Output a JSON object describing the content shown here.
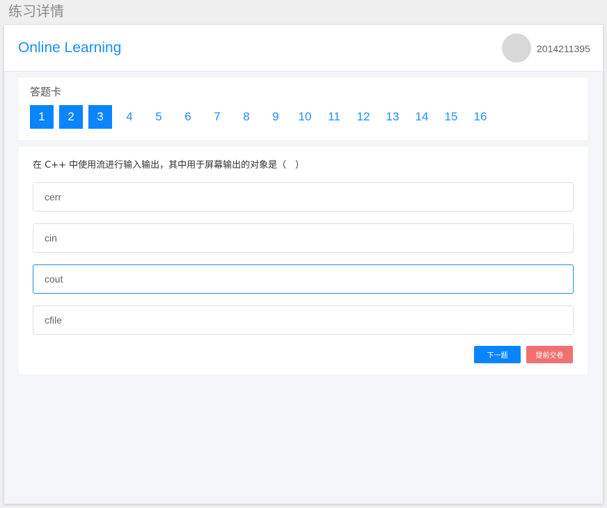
{
  "window": {
    "title": "练习详情"
  },
  "header": {
    "brand": "Online Learning",
    "user_id": "2014211395"
  },
  "answer_card": {
    "title": "答题卡",
    "numbers": [
      {
        "label": "1",
        "answered": true
      },
      {
        "label": "2",
        "answered": true
      },
      {
        "label": "3",
        "answered": true
      },
      {
        "label": "4",
        "answered": false
      },
      {
        "label": "5",
        "answered": false
      },
      {
        "label": "6",
        "answered": false
      },
      {
        "label": "7",
        "answered": false
      },
      {
        "label": "8",
        "answered": false
      },
      {
        "label": "9",
        "answered": false
      },
      {
        "label": "10",
        "answered": false
      },
      {
        "label": "11",
        "answered": false
      },
      {
        "label": "12",
        "answered": false
      },
      {
        "label": "13",
        "answered": false
      },
      {
        "label": "14",
        "answered": false
      },
      {
        "label": "15",
        "answered": false
      },
      {
        "label": "16",
        "answered": false
      }
    ]
  },
  "question": {
    "text": "在 C++ 中使用流进行输入输出，其中用于屏幕输出的对象是（　）",
    "options": [
      {
        "label": "cerr",
        "selected": false
      },
      {
        "label": "cin",
        "selected": false
      },
      {
        "label": "cout",
        "selected": true
      },
      {
        "label": "cfile",
        "selected": false
      }
    ]
  },
  "actions": {
    "next_label": "下一题",
    "submit_label": "提前交卷"
  },
  "colors": {
    "accent": "#0a84ff",
    "danger": "#f07070",
    "selected_border": "#1f8fe0"
  }
}
